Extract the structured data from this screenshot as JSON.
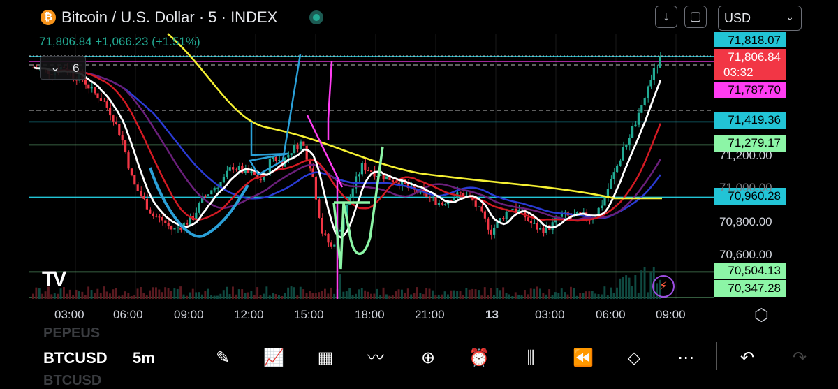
{
  "header": {
    "symbol_title": "Bitcoin / U.S. Dollar · 5 · INDEX",
    "logo_glyph": "₿",
    "download_icon": "download-icon",
    "fullscreen_icon": "fullscreen-icon",
    "currency": "USD",
    "quote": "71,806.84  +1,066.23 (+1.51%)",
    "quote_color": "#22ab94"
  },
  "legend": {
    "collapse_chevron": "⌄",
    "indicator_count": "6"
  },
  "price_labels": {
    "top_partial": "71,818.07",
    "last_price": "71,806.84",
    "countdown": "03:32",
    "magenta": "71,787.70",
    "cyan_upper": "71,419.36",
    "green_upper": "71,279.17",
    "cyan_lower": "70,960.28",
    "green_lower1": "70,504.13",
    "green_lower2": "70,347.28"
  },
  "price_axis": [
    "71,200.00",
    "71,000.00",
    "70,800.00",
    "70,600.00"
  ],
  "time_axis": [
    "03:00",
    "06:00",
    "09:00",
    "12:00",
    "15:00",
    "18:00",
    "21:00",
    "13",
    "03:00",
    "06:00",
    "09:00"
  ],
  "colors": {
    "up": "#22ab94",
    "down": "#f23645",
    "cyan": "#22c4d6",
    "green": "#8cf5a6",
    "magenta": "#ff3df2",
    "yellow": "#f5f032",
    "white": "#ffffff",
    "red_ma": "#d31a23",
    "blue_ma": "#2a3bd4",
    "purple_ma": "#6a1f7a",
    "pattern_blue": "#2aa0d8"
  },
  "chart_data": {
    "type": "candlestick",
    "symbol": "BTCUSD",
    "interval": "5",
    "ylim": [
      70340,
      71830
    ],
    "last_price": 71806.84,
    "change": 1066.23,
    "change_pct": 1.51,
    "horizontal_levels": [
      {
        "value": 71818.07,
        "color": "cyan"
      },
      {
        "value": 71787.7,
        "color": "magenta"
      },
      {
        "value": 71419.36,
        "color": "cyan"
      },
      {
        "value": 71279.17,
        "color": "green"
      },
      {
        "value": 70960.28,
        "color": "cyan"
      },
      {
        "value": 70504.13,
        "color": "green"
      },
      {
        "value": 70347.28,
        "color": "green"
      }
    ],
    "close_path": [
      71750,
      71735,
      71720,
      71760,
      71700,
      71680,
      71600,
      71550,
      71450,
      71300,
      71050,
      70950,
      70850,
      70820,
      70760,
      70790,
      70830,
      70950,
      71010,
      71060,
      71150,
      71120,
      71100,
      71060,
      71210,
      71170,
      71250,
      71300,
      71120,
      70750,
      70650,
      70800,
      71000,
      71150,
      71120,
      71090,
      71070,
      71050,
      71000,
      70990,
      70950,
      70920,
      70960,
      70980,
      70950,
      70860,
      70750,
      70830,
      70900,
      70870,
      70800,
      70760,
      70780,
      70850,
      70840,
      70850,
      70830,
      70900,
      71050,
      71200,
      71350,
      71470,
      71680,
      71800
    ]
  },
  "bottom": {
    "ghost_top": "PEPEUS",
    "symbol": "BTCUSD",
    "interval": "5m",
    "ghost_bottom": "BTCUSD",
    "tools": [
      "draw-icon",
      "indicators-icon",
      "templates-icon",
      "compare-icon",
      "add-icon",
      "alert-icon",
      "chart-type-icon",
      "replay-icon",
      "layers-icon",
      "more-icon",
      "undo-icon",
      "redo-icon"
    ]
  }
}
